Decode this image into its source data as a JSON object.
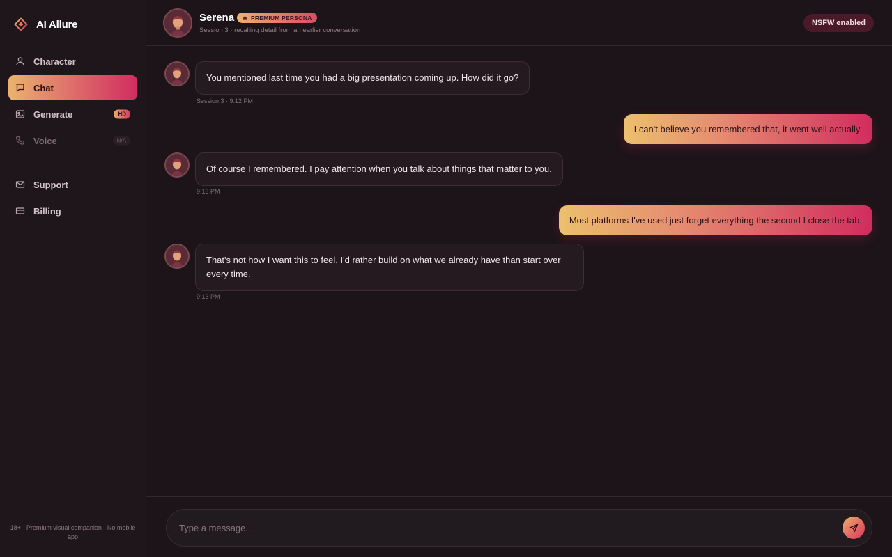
{
  "app": {
    "name": "AI Allure",
    "logo_icon": "diamond-logo-icon",
    "accent_gradient": [
      "#ecb36c",
      "#d02d60"
    ]
  },
  "sidebar": {
    "items": [
      {
        "label": "Character",
        "icon": "user-icon",
        "state": "normal"
      },
      {
        "label": "Chat",
        "icon": "chat-bubble-icon",
        "state": "active"
      },
      {
        "label": "Generate",
        "icon": "image-icon",
        "state": "normal",
        "badge": "HD"
      },
      {
        "label": "Voice",
        "icon": "phone-icon",
        "state": "disabled",
        "badge": "N/A"
      },
      {
        "label": "Support",
        "icon": "mail-icon",
        "state": "normal"
      },
      {
        "label": "Billing",
        "icon": "credit-card-icon",
        "state": "normal"
      }
    ],
    "footer": "18+ · Premium visual companion · No mobile app"
  },
  "header": {
    "persona_name": "Serena",
    "persona_badge": "PREMIUM PERSONA",
    "subtitle": "Session 3 · recalling detail from an earlier conversation",
    "nsfw_label": "NSFW enabled"
  },
  "messages": [
    {
      "from": "persona",
      "text": "You mentioned last time you had a big presentation coming up. How did it go?",
      "time": "Session 3 · 9:12 PM"
    },
    {
      "from": "user",
      "text": "I can't believe you remembered that, it went well actually."
    },
    {
      "from": "persona",
      "text": "Of course I remembered. I pay attention when you talk about things that matter to you.",
      "time": "9:13 PM"
    },
    {
      "from": "user",
      "text": "Most platforms I've used just forget everything the second I close the tab."
    },
    {
      "from": "persona",
      "text": "That's not how I want this to feel. I'd rather build on what we already have than start over every time.",
      "time": "9:13 PM"
    }
  ],
  "composer": {
    "placeholder": "Type a message...",
    "value": "",
    "send_icon": "send-icon"
  }
}
